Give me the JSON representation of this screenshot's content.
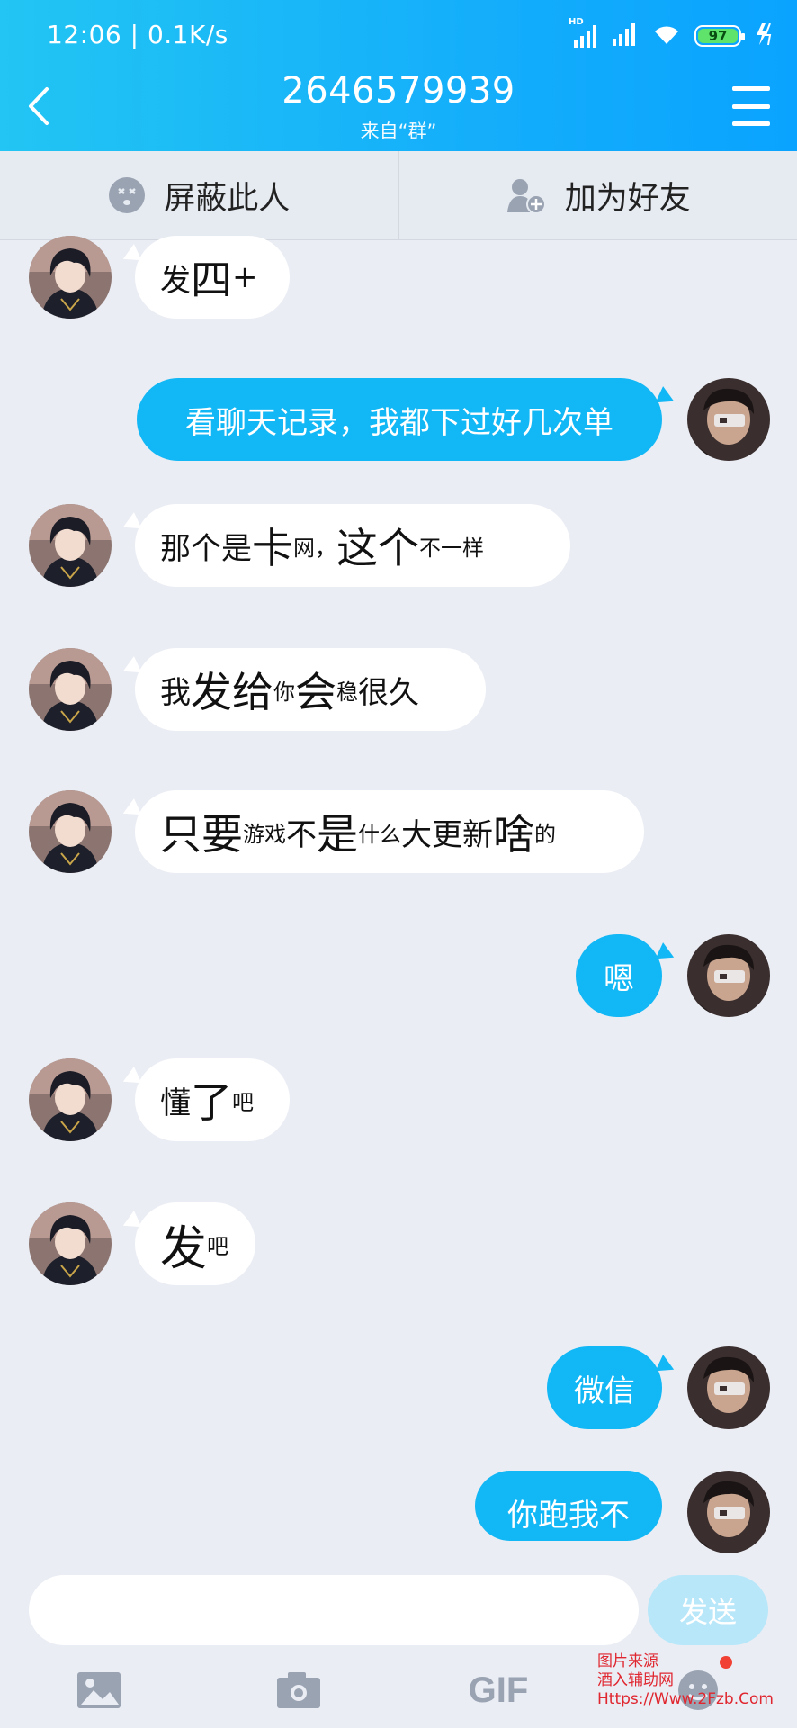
{
  "status_bar": {
    "time": "12:06",
    "speed": "0.1K/s",
    "hd": "HD",
    "battery": "97"
  },
  "header": {
    "title": "2646579939",
    "subtitle": "来自“群”"
  },
  "actions": {
    "block": "屏蔽此人",
    "add_friend": "加为好友"
  },
  "messages": [
    {
      "side": "in",
      "parts": [
        {
          "t": "发",
          "s": "m"
        },
        {
          "t": "四",
          "s": "l"
        },
        {
          "t": "+",
          "s": "m"
        }
      ]
    },
    {
      "side": "out",
      "text": "看聊天记录，我都下过好几次单"
    },
    {
      "side": "in",
      "parts": [
        {
          "t": "那个是",
          "s": "m"
        },
        {
          "t": "卡",
          "s": "l"
        },
        {
          "t": "网，",
          "s": "s"
        },
        {
          "t": "这个",
          "s": "l"
        },
        {
          "t": "不一样",
          "s": "s"
        }
      ]
    },
    {
      "side": "in",
      "parts": [
        {
          "t": "我",
          "s": "m"
        },
        {
          "t": "发给",
          "s": "l"
        },
        {
          "t": "你",
          "s": "s"
        },
        {
          "t": "会",
          "s": "l"
        },
        {
          "t": "稳",
          "s": "s"
        },
        {
          "t": "很久",
          "s": "m"
        }
      ]
    },
    {
      "side": "in",
      "parts": [
        {
          "t": "只要",
          "s": "l"
        },
        {
          "t": "游戏",
          "s": "s"
        },
        {
          "t": "不",
          "s": "m"
        },
        {
          "t": "是",
          "s": "l"
        },
        {
          "t": "什么",
          "s": "s"
        },
        {
          "t": "大更新",
          "s": "m"
        },
        {
          "t": "啥",
          "s": "l"
        },
        {
          "t": "的",
          "s": "s"
        }
      ]
    },
    {
      "side": "out",
      "text": "嗯"
    },
    {
      "side": "in",
      "parts": [
        {
          "t": "懂",
          "s": "m"
        },
        {
          "t": "了",
          "s": "l"
        },
        {
          "t": "吧",
          "s": "s"
        }
      ]
    },
    {
      "side": "in",
      "parts": [
        {
          "t": "发",
          "s": "xl"
        },
        {
          "t": "吧",
          "s": "s"
        }
      ]
    },
    {
      "side": "out",
      "text": "微信"
    },
    {
      "side": "out",
      "text": "你跑我不"
    }
  ],
  "input": {
    "placeholder": "",
    "send_label": "发送"
  },
  "toolbar": {
    "gif_label": "GIF"
  },
  "watermark": {
    "line1": "图片来源",
    "line2": "酒入辅助网",
    "line3": "Https://Www.2Fzb.Com"
  }
}
